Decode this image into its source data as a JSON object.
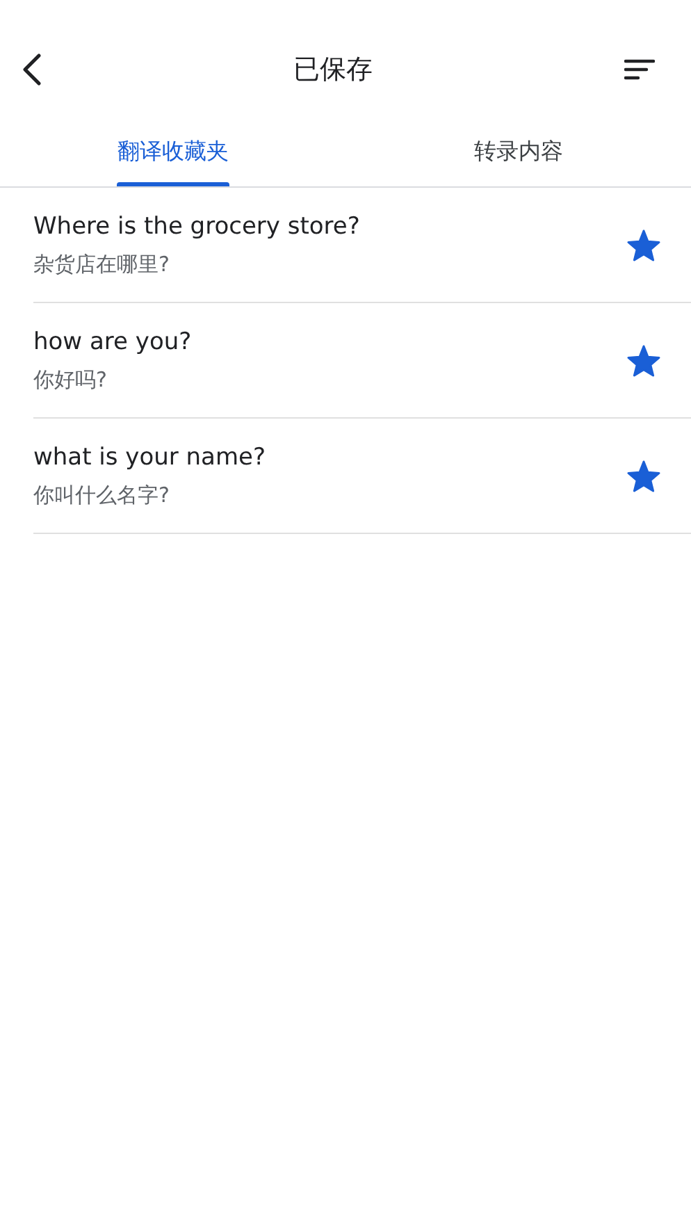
{
  "header": {
    "title": "已保存"
  },
  "tabs": [
    {
      "label": "翻译收藏夹",
      "selected": true
    },
    {
      "label": "转录内容",
      "selected": false
    }
  ],
  "items": [
    {
      "source": "Where is the grocery store?",
      "translation": "杂货店在哪里?",
      "starred": true
    },
    {
      "source": "how are you?",
      "translation": "你好吗?",
      "starred": true
    },
    {
      "source": "what is your name?",
      "translation": "你叫什么名字?",
      "starred": true
    }
  ]
}
